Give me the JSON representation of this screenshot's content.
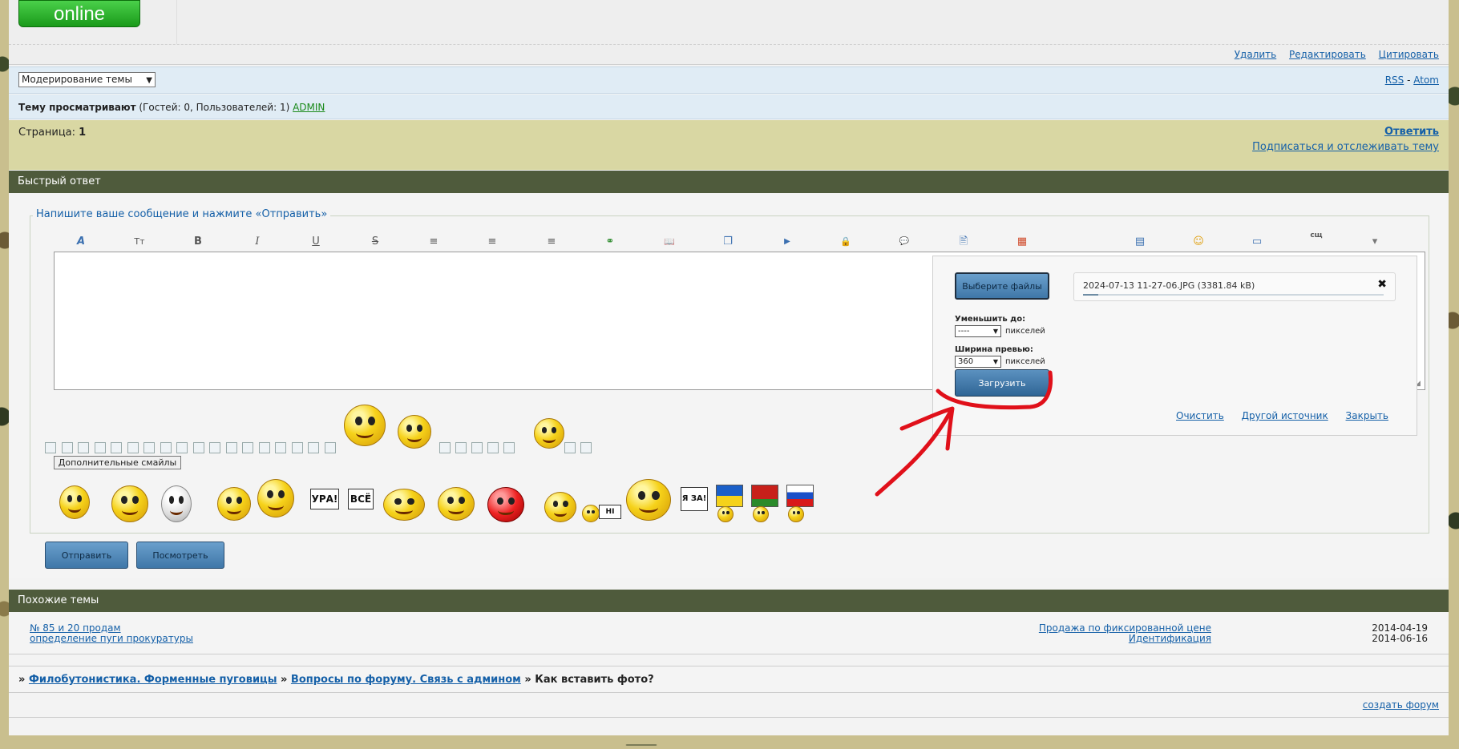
{
  "status": {
    "online_label": "online"
  },
  "post_actions": {
    "delete": "Удалить",
    "edit": "Редактировать",
    "quote": "Цитировать"
  },
  "moderation": {
    "select_value": "Модерирование темы",
    "rss": "RSS",
    "separator": "-",
    "atom": "Atom"
  },
  "viewers": {
    "label": "Тему просматривают",
    "counts": "(Гостей: 0, Пользователей: 1)",
    "user": "ADMIN"
  },
  "pagination": {
    "label": "Страница:",
    "current": "1",
    "reply": "Ответить",
    "subscribe": "Подписаться и отслеживать тему"
  },
  "quick_reply": {
    "header": "Быстрый ответ",
    "legend": "Напишите ваше сообщение и нажмите «Отправить»",
    "toolbar_glyphs": [
      "A",
      "Tт",
      "B",
      "I",
      "U",
      "S",
      "≡",
      "≡",
      "≡",
      "⚭",
      "📖",
      "❐",
      "▶",
      "🔒",
      "💬",
      "🖹",
      "▦",
      "▤",
      "☺",
      "▭",
      "сщ",
      "▾"
    ],
    "more_smiles": "Дополнительные смайлы",
    "send": "Отправить",
    "preview": "Посмотреть",
    "signs": [
      "УРА!",
      "ВСЁ",
      "Я ЗА!",
      "HI"
    ]
  },
  "upload": {
    "choose_button": "Выберите файлы",
    "file_name": "2024-07-13 11-27-06.JPG (3381.84 kB)",
    "file_progress": 0.05,
    "reduce_label": "Уменьшить до:",
    "reduce_value": "----",
    "units1": "пикселей",
    "preview_label": "Ширина превью:",
    "preview_value": "360",
    "units2": "пикселей",
    "upload_button": "Загрузить",
    "links": {
      "clear": "Очистить",
      "other_source": "Другой источник",
      "close": "Закрыть"
    }
  },
  "similar": {
    "header": "Похожие темы",
    "rows": [
      {
        "left": "№ 85 и 20 продам",
        "right": "Продажа по фиксированной цене",
        "date": "2014-04-19"
      },
      {
        "left": "определение пуги прокуратуры",
        "right": "Идентификация",
        "date": "2014-06-16"
      }
    ]
  },
  "breadcrumb": {
    "sep": "»",
    "forum": "Филобутонистика. Форменные пуговицы",
    "section": "Вопросы по форуму. Связь с админом",
    "current": "Как вставить фото?"
  },
  "footer": {
    "create_forum": "создать форум"
  },
  "colors": {
    "header_bg": "#4f5b3c",
    "page_bar_bg": "#d9d7a3",
    "link": "#1560a8",
    "annotation_arrow": "#e0101a"
  }
}
